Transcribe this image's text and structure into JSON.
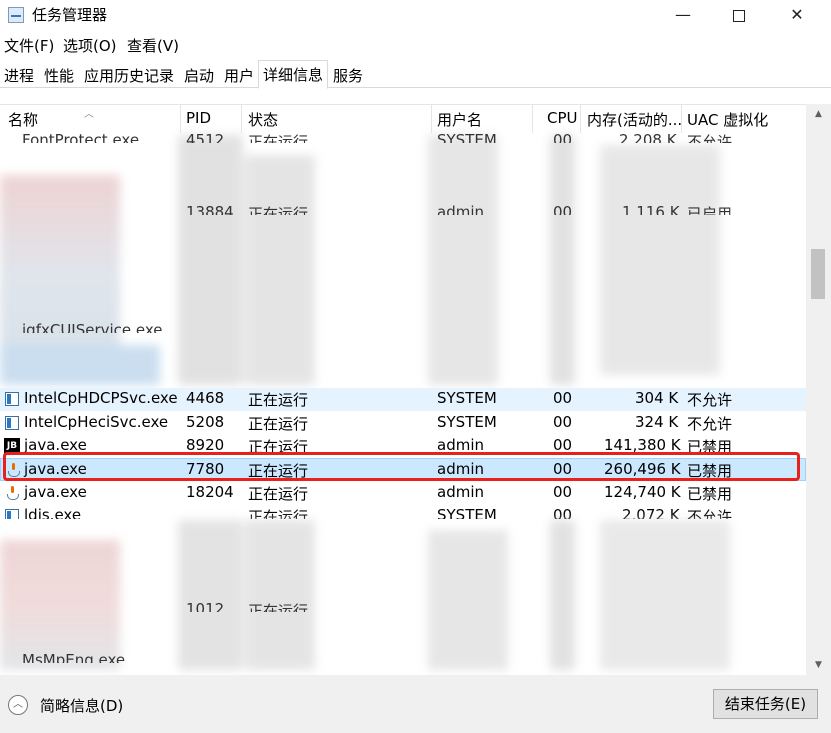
{
  "window": {
    "title": "任务管理器",
    "minimize": "—",
    "close": "✕"
  },
  "menu": {
    "file": "文件(F)",
    "options": "选项(O)",
    "view": "查看(V)"
  },
  "tabs": [
    "进程",
    "性能",
    "应用历史记录",
    "启动",
    "用户",
    "详细信息",
    "服务"
  ],
  "columns": {
    "name": "名称",
    "pid": "PID",
    "status": "状态",
    "user": "用户名",
    "cpu": "CPU",
    "memory": "内存(活动的...",
    "uac": "UAC 虚拟化"
  },
  "rows": [
    {
      "name": "IntelCpHDCPSvc.exe",
      "pid": "4468",
      "status": "正在运行",
      "user": "SYSTEM",
      "cpu": "00",
      "memory": "304 K",
      "uac": "不允许",
      "icon": "exe-icon"
    },
    {
      "name": "IntelCpHeciSvc.exe",
      "pid": "5208",
      "status": "正在运行",
      "user": "SYSTEM",
      "cpu": "00",
      "memory": "324 K",
      "uac": "不允许",
      "icon": "exe-icon"
    },
    {
      "name": "java.exe",
      "pid": "8920",
      "status": "正在运行",
      "user": "admin",
      "cpu": "00",
      "memory": "141,380 K",
      "uac": "已禁用",
      "icon": "jetbrains-icon",
      "icon_text": "JB"
    },
    {
      "name": "java.exe",
      "pid": "7780",
      "status": "正在运行",
      "user": "admin",
      "cpu": "00",
      "memory": "260,496 K",
      "uac": "已禁用",
      "icon": "java-icon"
    },
    {
      "name": "java.exe",
      "pid": "18204",
      "status": "正在运行",
      "user": "admin",
      "cpu": "00",
      "memory": "124,740 K",
      "uac": "已禁用",
      "icon": "java-icon"
    }
  ],
  "partial_rows": [
    {
      "name": "FontProtect.exe",
      "pid": "4512",
      "status": "正在运行",
      "user": "SYSTEM",
      "cpu": "00",
      "memory": "2,208 K",
      "uac": "不允许"
    },
    {
      "pid": "13884",
      "status": "正在运行",
      "user": "admin",
      "cpu": "00",
      "memory": "1,116 K",
      "uac": "已启用"
    },
    {
      "name": "igfxCUIService.exe"
    },
    {
      "name": "ldis.exe",
      "status": "正在运行",
      "user": "SYSTEM",
      "cpu": "00",
      "memory": "2,072 K",
      "uac": "不允许"
    },
    {
      "pid": "1012",
      "status": "正在运行"
    },
    {
      "name": "MsMpEng.exe"
    }
  ],
  "footer": {
    "fewer_details": "简略信息(D)",
    "end_task": "结束任务(E)"
  }
}
